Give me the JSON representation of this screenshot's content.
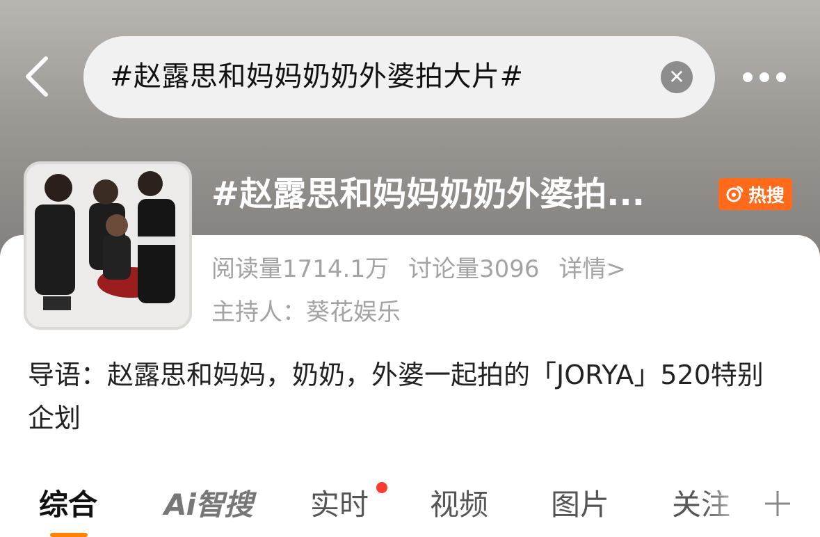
{
  "nav": {
    "search_query": "#赵露思和妈妈奶奶外婆拍大片#",
    "clear_icon": "close-icon",
    "more_icon": "more-icon"
  },
  "topic": {
    "title": "#赵露思和妈妈奶奶外婆拍...",
    "badge_label": "热搜",
    "reads": "阅读量1714.1万",
    "discussions": "讨论量3096",
    "details_link": "详情>",
    "host": "主持人：葵花娱乐",
    "intro": "导语：赵露思和妈妈，奶奶，外婆一起拍的「JORYA」520特别企划"
  },
  "tabs": [
    {
      "label": "综合",
      "active": true
    },
    {
      "label": "Ai智搜",
      "active": false
    },
    {
      "label": "实时",
      "active": false,
      "has_dot": true
    },
    {
      "label": "视频",
      "active": false
    },
    {
      "label": "图片",
      "active": false
    },
    {
      "label": "关注",
      "active": false
    }
  ],
  "colors": {
    "accent": "#ff8200",
    "hot_badge": "#ff6b1a",
    "dot": "#ff3b30"
  }
}
